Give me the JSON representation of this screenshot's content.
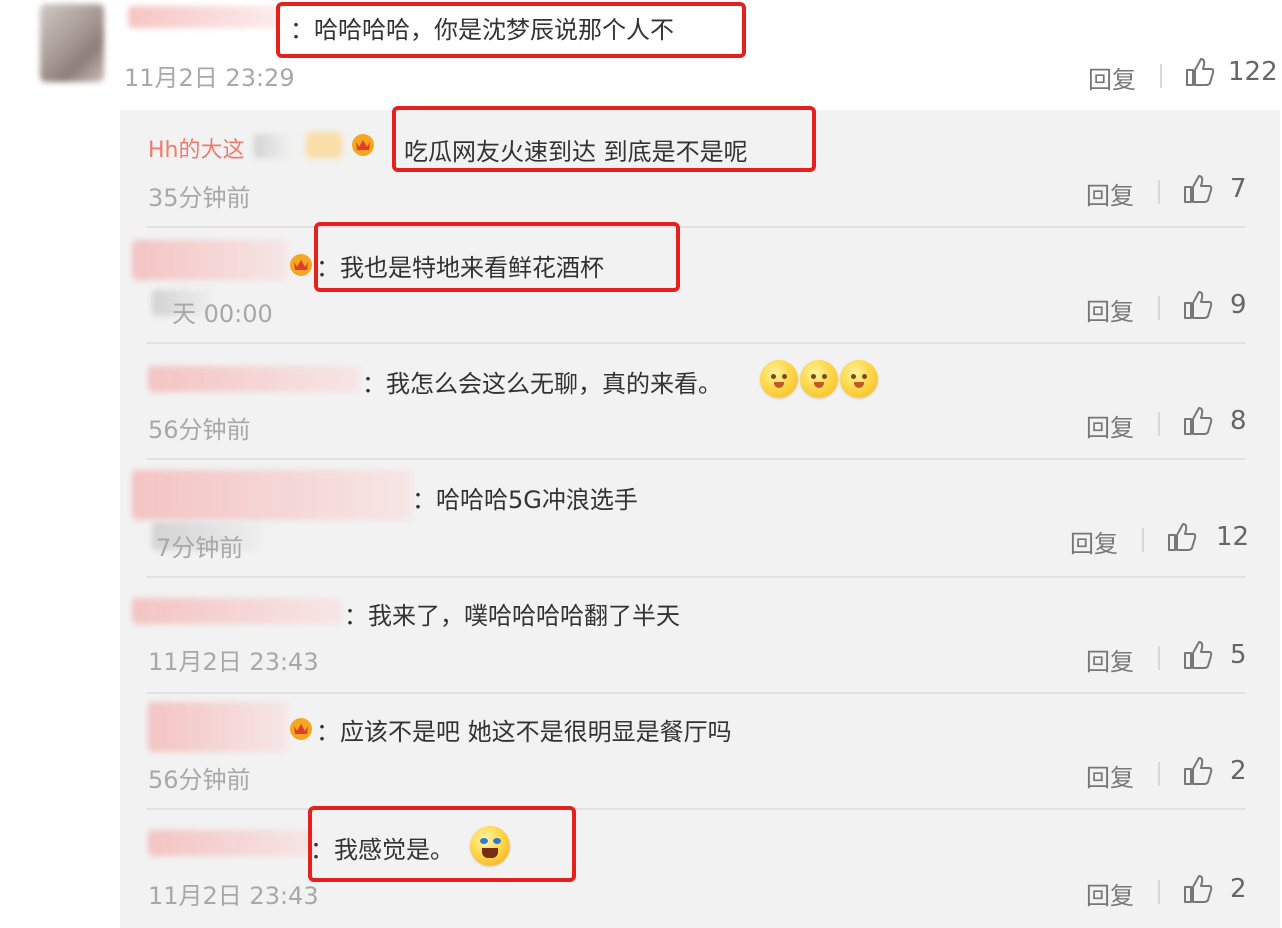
{
  "top_comment": {
    "text": "：哈哈哈哈，你是沈梦辰说那个人不",
    "time": "11月2日 23:29",
    "reply_label": "回复",
    "likes": "122"
  },
  "replies": [
    {
      "name": "Hh的大这",
      "text": "吃瓜网友火速到达 到底是不是呢",
      "time": "35分钟前",
      "reply_label": "回复",
      "likes": "7"
    },
    {
      "text": "：我也是特地来看鲜花酒杯",
      "time": "天 00:00",
      "reply_label": "回复",
      "likes": "9"
    },
    {
      "text": "：我怎么会这么无聊，真的来看。",
      "time": "56分钟前",
      "reply_label": "回复",
      "likes": "8"
    },
    {
      "text": "：哈哈哈5G冲浪选手",
      "time": "7分钟前",
      "reply_label": "回复",
      "likes": "12"
    },
    {
      "text": "：我来了，噗哈哈哈哈翻了半天",
      "time": "11月2日 23:43",
      "reply_label": "回复",
      "likes": "5"
    },
    {
      "text": "：应该不是吧 她这不是很明显是餐厅吗",
      "time": "56分钟前",
      "reply_label": "回复",
      "likes": "2"
    },
    {
      "text": "：我感觉是。",
      "time": "11月2日 23:43",
      "reply_label": "回复",
      "likes": "2"
    }
  ],
  "colors": {
    "highlight_box": "#e5211d",
    "reply_panel_bg": "#f2f2f2",
    "name_accent": "#f07a6c"
  },
  "icons": [
    "thumbs-up-icon",
    "emoji-icon",
    "crown-badge-icon"
  ]
}
